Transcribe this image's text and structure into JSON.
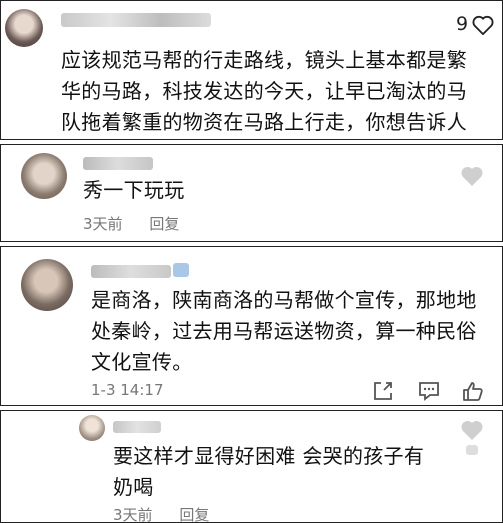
{
  "comments": [
    {
      "like_count": "9",
      "text": "应该规范马帮的行走路线，镜头上基本都是繁华的马路，科技发达的今天，让早已淘汰的马队拖着繁重的物资在马路上行走，你想告诉人们什么"
    },
    {
      "text": "秀一下玩玩",
      "time": "3天前",
      "reply_label": "回复"
    },
    {
      "text": "是商洛，陕南商洛的马帮做个宣传，那地地处秦岭，过去用马帮运送物资，算一种民俗文化宣传。",
      "time": "1-3 14:17"
    },
    {
      "text": "要这样才显得好困难 会哭的孩子有奶喝",
      "time": "3天前",
      "reply_label": "回复"
    }
  ]
}
